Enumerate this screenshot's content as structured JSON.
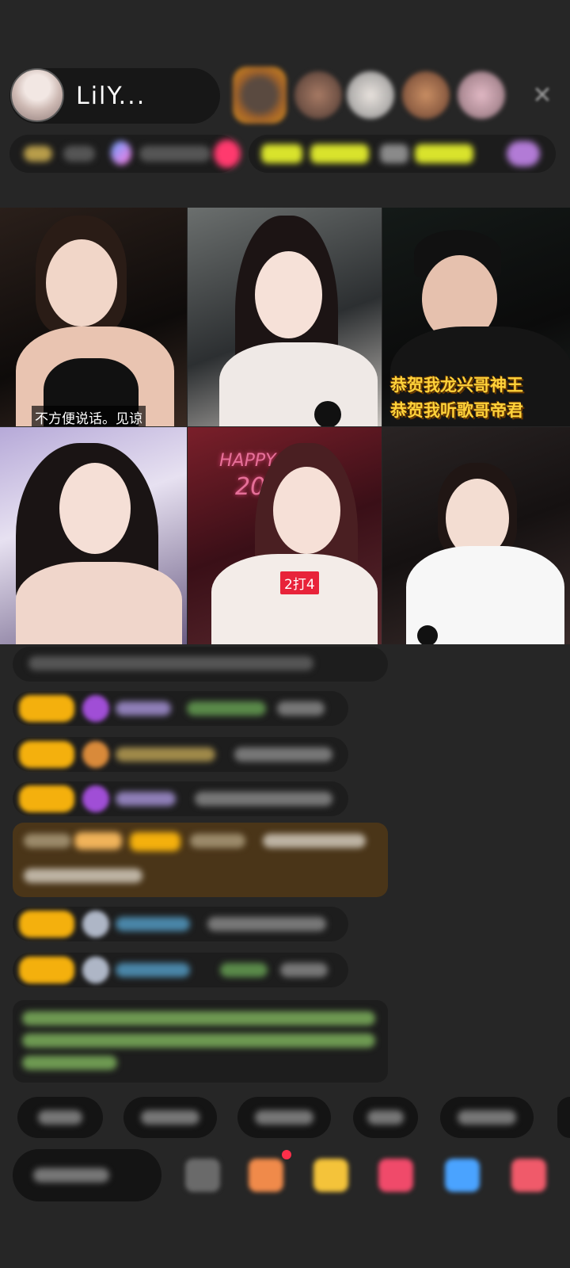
{
  "header": {
    "host_name": "LilY...",
    "close_icon": "close-icon"
  },
  "video_grid": {
    "cells": [
      {
        "id": 1,
        "caption": "不方便说话。见谅"
      },
      {
        "id": 2,
        "caption": ""
      },
      {
        "id": 3,
        "overlay_lines": [
          "恭贺我龙兴哥神王",
          "恭贺我听歌哥帝君"
        ]
      },
      {
        "id": 4,
        "caption": ""
      },
      {
        "id": 5,
        "tag": "2打4",
        "neon_text": "HAPPY",
        "neon_number": "20"
      },
      {
        "id": 6,
        "caption": ""
      }
    ]
  },
  "colors": {
    "background": "#262626",
    "badge_yellow": "#f4b00d",
    "gold_text": "#ffd23a",
    "tag_red": "#e8233a",
    "gift_row_bg": "#4a3518"
  }
}
